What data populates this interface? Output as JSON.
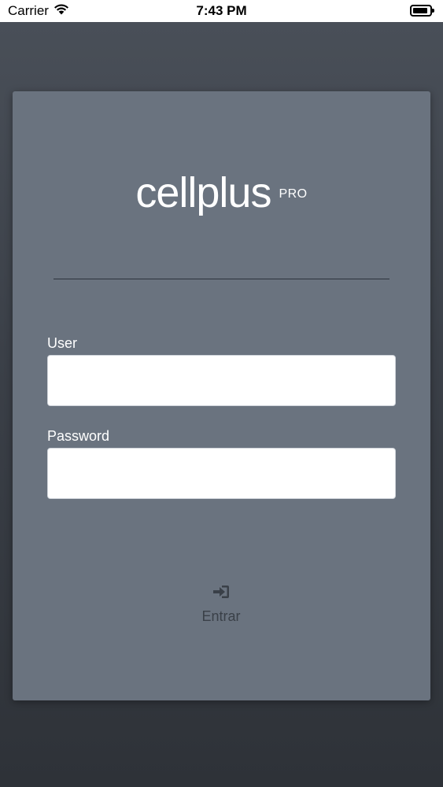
{
  "status_bar": {
    "carrier": "Carrier",
    "time": "7:43 PM",
    "icons": [
      "wifi-icon",
      "battery-icon"
    ]
  },
  "logo": {
    "main": "cellplus",
    "suffix": "PRO"
  },
  "form": {
    "user_label": "User",
    "user_value": "",
    "password_label": "Password",
    "password_value": ""
  },
  "login_button": {
    "label": "Entrar",
    "icon": "sign-in-icon"
  },
  "colors": {
    "background": "#3b4048",
    "card": "#6a737f",
    "input": "#ffffff",
    "button_text": "#3a4048"
  }
}
